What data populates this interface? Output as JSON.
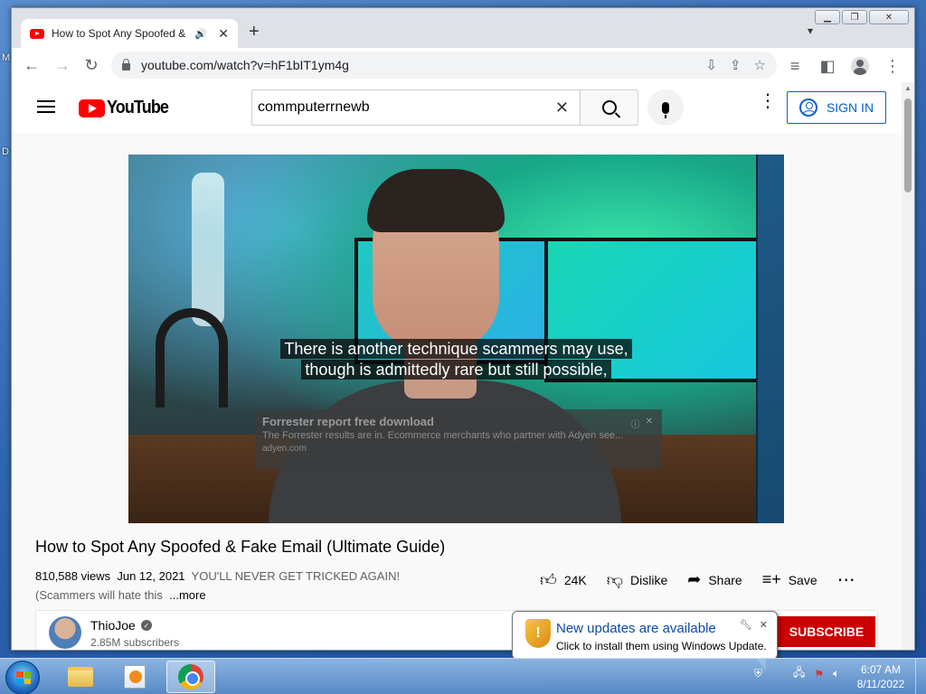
{
  "desktop": {
    "letters": [
      "M",
      "D"
    ]
  },
  "browser": {
    "tab_title": "How to Spot Any Spoofed & Fake Email (Ultimate Guide)",
    "tab_audio_icon": "speaker-icon",
    "tab_close": "✕",
    "new_tab": "+",
    "url": "youtube.com/watch?v=hF1bIT1ym4g"
  },
  "youtube": {
    "logo_text": "YouTube",
    "search_value": "commputerrnewb",
    "sign_in": "SIGN IN",
    "video": {
      "caption_line1": "There is another technique scammers may use,",
      "caption_line2": "though is admittedly rare but still possible,",
      "ad_title": "Forrester report free download",
      "ad_desc": "The Forrester results are in. Ecommerce merchants who partner with Adyen see...",
      "ad_url": "adyen.com"
    },
    "title": "How to Spot Any Spoofed & Fake Email (Ultimate Guide)",
    "views": "810,588 views",
    "date": "Jun 12, 2021",
    "description": "YOU'LL NEVER GET TRICKED AGAIN! (Scammers will hate this",
    "more": "...more",
    "actions": {
      "likes": "24K",
      "dislike": "Dislike",
      "share": "Share",
      "save": "Save"
    },
    "channel": {
      "name": "ThioJoe",
      "subscribers": "2.85M subscribers",
      "subscribe": "SUBSCRIBE"
    }
  },
  "balloon": {
    "title": "New updates are available",
    "text": "Click to install them using Windows Update."
  },
  "taskbar": {
    "time": "6:07 AM",
    "date": "8/11/2022"
  },
  "colors": {
    "youtube_red": "#ff0000",
    "subscribe_red": "#cc0000",
    "link_blue": "#065fd4"
  }
}
